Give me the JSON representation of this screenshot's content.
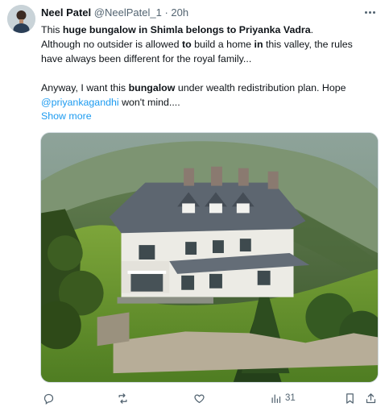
{
  "tweet": {
    "display_name": "Neel Patel",
    "handle": "@NeelPatel_1",
    "separator": "·",
    "time": "20h",
    "line1_pre": "This ",
    "line1_bold1": "huge bungalow in Shimla belongs to Priyanka Vadra",
    "line1_post": ".",
    "line2_pre": "Although no outsider is allowed ",
    "line2_bold_to": "to",
    "line2_mid": " build a home ",
    "line2_bold_in": "in",
    "line2_post": " this valley, the rules",
    "line3": "have always been different for the royal family...",
    "line4_pre": "Anyway, I want this ",
    "line4_bold": "bungalow",
    "line4_post": " under wealth redistribution plan. Hope",
    "mention": "@priyankagandhi",
    "line5_post": " won't mind....",
    "show_more": "Show more"
  },
  "actions": {
    "views_count": "31"
  },
  "icons": {
    "reply": "reply-icon",
    "retweet": "retweet-icon",
    "like": "heart-icon",
    "views": "views-icon",
    "bookmark": "bookmark-icon",
    "share": "share-icon",
    "more": "more-icon"
  },
  "colors": {
    "link": "#1d9bf0",
    "secondary_text": "#536471",
    "primary_text": "#0f1419"
  }
}
